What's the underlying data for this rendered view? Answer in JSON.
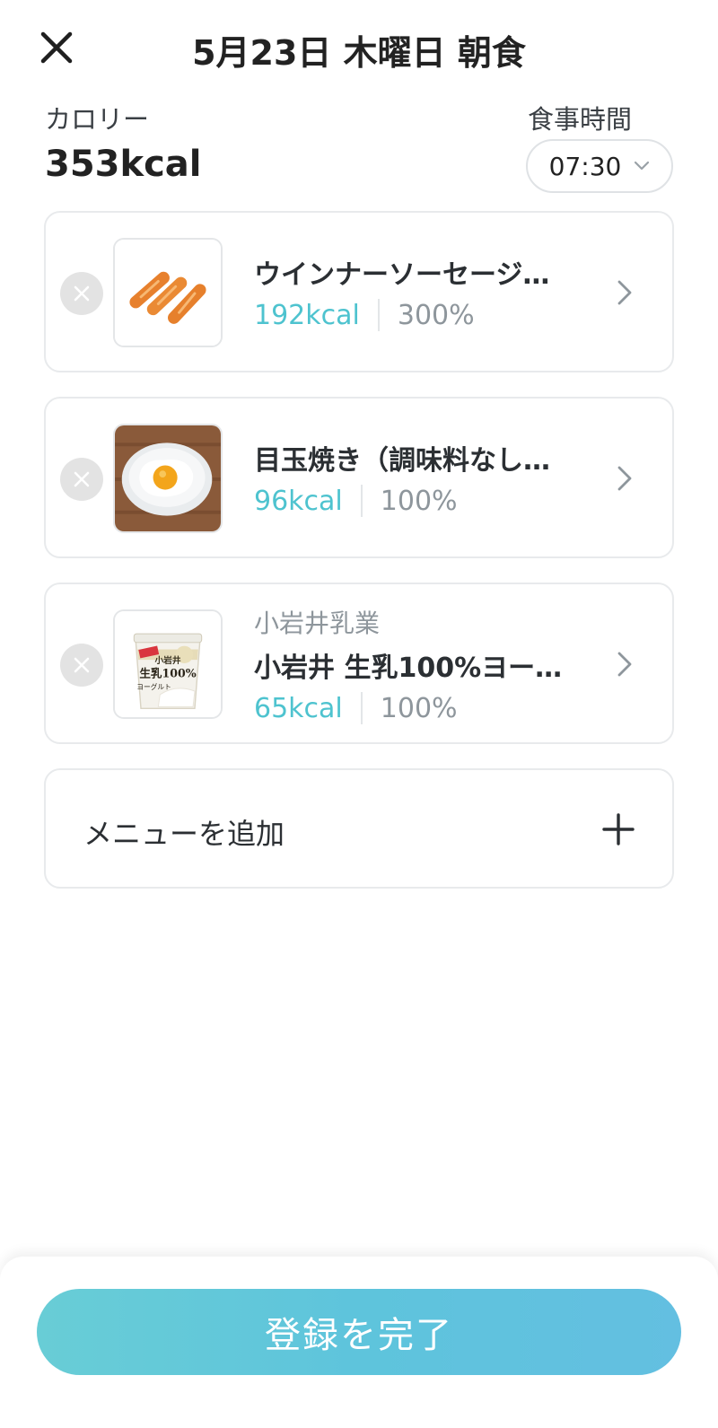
{
  "header": {
    "title": "5月23日 木曜日 朝食",
    "close_icon": "close-icon"
  },
  "summary": {
    "calorie_label": "カロリー",
    "calorie_value": "353kcal",
    "time_label": "食事時間",
    "time_value": "07:30"
  },
  "items": [
    {
      "brand": "",
      "name": "ウインナーソーセージ…",
      "kcal": "192kcal",
      "percent": "300%",
      "image": "sausages"
    },
    {
      "brand": "",
      "name": "目玉焼き（調味料なし…",
      "kcal": "96kcal",
      "percent": "100%",
      "image": "fried-egg"
    },
    {
      "brand": "小岩井乳業",
      "name": "小岩井 生乳100%ヨー…",
      "kcal": "65kcal",
      "percent": "100%",
      "image": "yogurt-cup",
      "image_text": [
        "小岩井",
        "生乳100%",
        "ヨーグルト"
      ]
    }
  ],
  "add_menu": {
    "label": "メニューを追加",
    "icon": "plus-icon"
  },
  "footer": {
    "submit_label": "登録を完了"
  },
  "colors": {
    "accent_kcal": "#4ec3cf",
    "button_gradient_start": "#68cdd6",
    "button_gradient_end": "#63bfe1",
    "muted_text": "#8e969c"
  }
}
